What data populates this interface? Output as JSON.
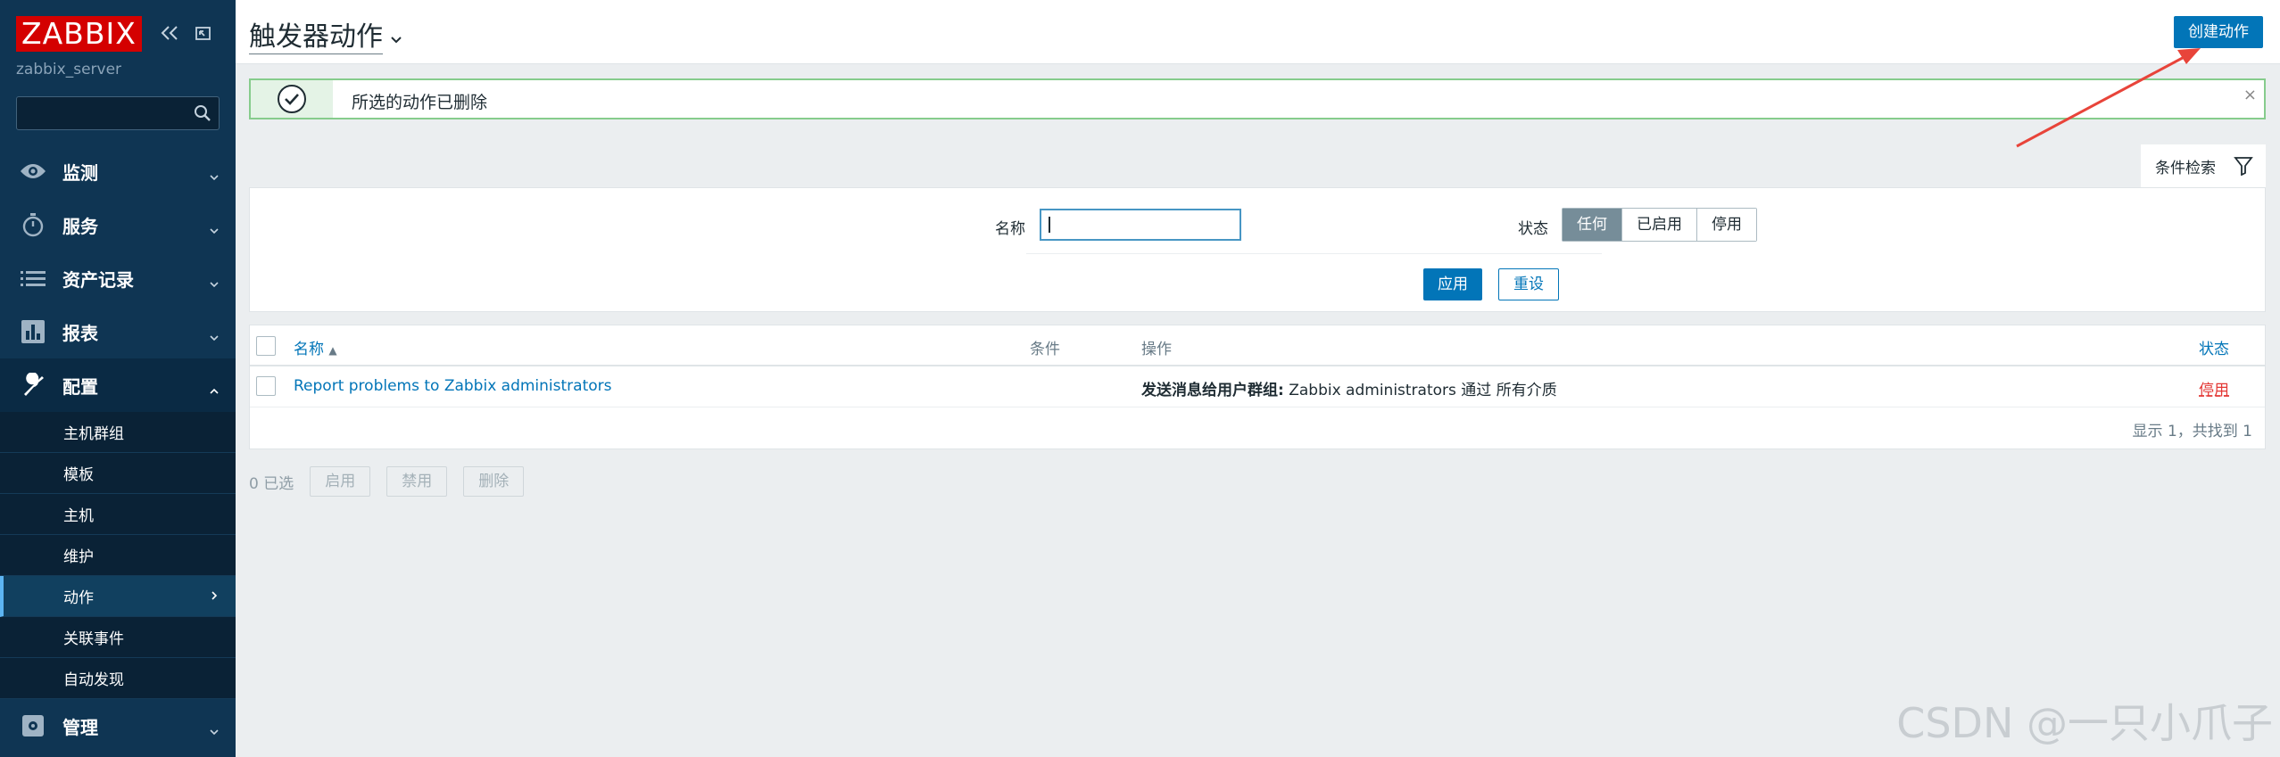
{
  "brand": {
    "logo_text": "ZABBIX",
    "server": "zabbix_server"
  },
  "sidebar": {
    "menu": [
      {
        "label": "监测",
        "icon": "eye-icon"
      },
      {
        "label": "服务",
        "icon": "stopwatch-icon"
      },
      {
        "label": "资产记录",
        "icon": "list-icon"
      },
      {
        "label": "报表",
        "icon": "bar-chart-icon"
      },
      {
        "label": "配置",
        "icon": "wrench-icon"
      }
    ],
    "submenu": [
      "主机群组",
      "模板",
      "主机",
      "维护",
      "动作",
      "关联事件",
      "自动发现"
    ],
    "admin": {
      "label": "管理",
      "icon": "gear-icon"
    }
  },
  "header": {
    "title": "触发器动作",
    "create_button": "创建动作"
  },
  "message": {
    "text": "所选的动作已删除",
    "close": "×"
  },
  "filter": {
    "tab_label": "条件检索",
    "name_label": "名称",
    "name_value": "",
    "status_label": "状态",
    "status_options": [
      "任何",
      "已启用",
      "停用"
    ],
    "status_selected": "任何",
    "apply": "应用",
    "reset": "重设"
  },
  "table": {
    "headers": {
      "name": "名称",
      "name_sort": "▲",
      "conditions": "条件",
      "operations": "操作",
      "status": "状态"
    },
    "rows": [
      {
        "name": "Report problems to Zabbix administrators",
        "conditions": "",
        "operations_bold": "发送消息给用户群组:",
        "operations_rest": " Zabbix administrators 通过 所有介质",
        "status": "停用"
      }
    ],
    "summary": "显示 1，共找到 1"
  },
  "bulk": {
    "selected": "0 已选",
    "enable": "启用",
    "disable": "禁用",
    "delete": "删除"
  },
  "watermark": "CSDN @一只小爪子",
  "colors": {
    "sidebar": "#0f3553",
    "accent": "#0275b8",
    "success": "#86cc8c",
    "danger": "#e33734",
    "logo": "#d40000"
  }
}
